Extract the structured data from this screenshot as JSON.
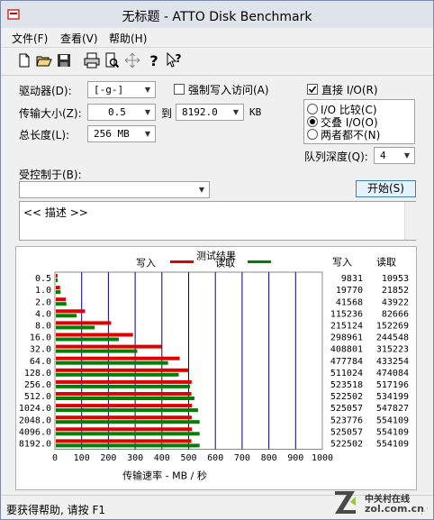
{
  "window": {
    "title": "无标题 - ATTO Disk Benchmark"
  },
  "menu": [
    "文件(F)",
    "查看(V)",
    "帮助(H)"
  ],
  "toolbar": [
    "new-icon",
    "open-icon",
    "save-icon",
    "print-icon",
    "print-preview-icon",
    "move-icon",
    "help-icon",
    "context-help-icon"
  ],
  "settings": {
    "drive_label": "驱动器(D):",
    "drive_value": "[-g-]",
    "force_write_label": "强制写入访问(A)",
    "direct_io_label": "直接 I/O(R)",
    "transfer_label": "传输大小(Z):",
    "transfer_from": "0.5",
    "to_label": "到",
    "transfer_to": "8192.0",
    "kb_label": "KB",
    "total_label": "总长度(L):",
    "total_value": "256 MB",
    "io_options": [
      "I/O 比较(C)",
      "交叠 I/O(O)",
      "两者都不(N)"
    ],
    "io_selected": 1,
    "queue_label": "队列深度(Q):",
    "queue_value": "4",
    "controlled_label": "受控制于(B):",
    "controlled_value": "",
    "start_button": "开始(S)",
    "description": "<< 描述 >>"
  },
  "status": {
    "text": "要获得帮助, 请按 F1",
    "watermark": "中关村在线",
    "watermark_url": "zol.com.cn"
  },
  "colors": {
    "write": "#e00000",
    "read": "#008000",
    "grid": "#00008b"
  },
  "chart_data": {
    "type": "bar",
    "title": "测试结果",
    "xlabel": "传输速率 - MB / 秒",
    "xlim": [
      0,
      1000
    ],
    "xticks": [
      0,
      100,
      200,
      300,
      400,
      500,
      600,
      700,
      800,
      900,
      1000
    ],
    "categories": [
      "0.5",
      "1.0",
      "2.0",
      "4.0",
      "8.0",
      "16.0",
      "32.0",
      "64.0",
      "128.0",
      "256.0",
      "512.0",
      "1024.0",
      "2048.0",
      "4096.0",
      "8192.0"
    ],
    "series": [
      {
        "name": "写入",
        "color": "#e00000",
        "values": [
          9831,
          19770,
          41568,
          115236,
          215124,
          298961,
          408801,
          477784,
          511024,
          523518,
          522502,
          525057,
          523776,
          525057,
          522502
        ]
      },
      {
        "name": "读取",
        "color": "#008000",
        "values": [
          10953,
          21852,
          43922,
          82666,
          152269,
          244548,
          315223,
          433254,
          474084,
          517196,
          534199,
          547827,
          554109,
          554109,
          554109
        ]
      }
    ],
    "column_headers": [
      "写入",
      "读取"
    ]
  }
}
